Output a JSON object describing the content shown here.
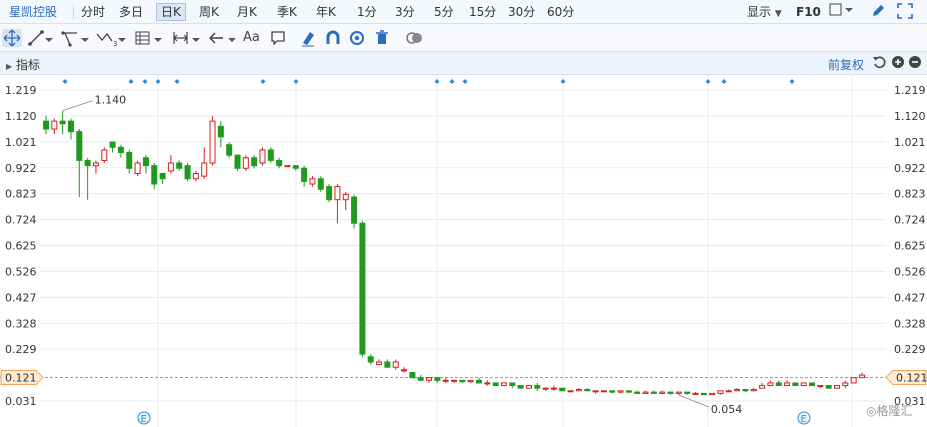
{
  "stock_name": "星凯控股",
  "period_tabs": [
    "分时",
    "多日",
    "日K",
    "周K",
    "月K",
    "季K",
    "年K",
    "1分",
    "3分",
    "5分",
    "15分",
    "30分",
    "60分"
  ],
  "active_tab": "日K",
  "display_label": "显示",
  "f10_label": "F10",
  "toolbar": {
    "text_tool_label": "Aa"
  },
  "header": {
    "indicator_label": "指标",
    "adjust_label": "前复权"
  },
  "watermark": "格隆汇",
  "event_marker": "E",
  "colors": {
    "up": "#d61f1f",
    "down": "#1f9a1f",
    "grid": "#e3ecf6",
    "current_price": "#f08a24",
    "accent": "#2a6bc4"
  },
  "chart_data": {
    "type": "candlestick",
    "title": "",
    "ylim": [
      0.0,
      1.25
    ],
    "y_ticks": [
      "1.219",
      "1.120",
      "1.021",
      "0.922",
      "0.823",
      "0.724",
      "0.625",
      "0.526",
      "0.427",
      "0.328",
      "0.229",
      "0.121",
      "0.031"
    ],
    "current_price": "0.121",
    "annotations": {
      "high": "1.140",
      "low": "0.054"
    },
    "event_dot_count": 14,
    "event_marker_count": 2,
    "candles": [
      [
        1.1,
        1.07,
        1.12,
        1.05
      ],
      [
        1.07,
        1.1,
        1.11,
        1.05
      ],
      [
        1.1,
        1.09,
        1.14,
        1.05
      ],
      [
        1.1,
        1.06,
        1.11,
        1.03
      ],
      [
        1.06,
        0.95,
        1.07,
        0.81
      ],
      [
        0.95,
        0.93,
        0.96,
        0.8
      ],
      [
        0.93,
        0.94,
        0.95,
        0.9
      ],
      [
        0.95,
        0.99,
        1.0,
        0.94
      ],
      [
        1.02,
        1.0,
        1.02,
        0.98
      ],
      [
        1.0,
        0.98,
        1.01,
        0.96
      ],
      [
        0.98,
        0.92,
        0.99,
        0.9
      ],
      [
        0.9,
        0.94,
        0.95,
        0.89
      ],
      [
        0.96,
        0.93,
        0.97,
        0.9
      ],
      [
        0.93,
        0.86,
        0.94,
        0.84
      ],
      [
        0.9,
        0.88,
        0.9,
        0.86
      ],
      [
        0.91,
        0.94,
        0.97,
        0.9
      ],
      [
        0.94,
        0.92,
        0.95,
        0.91
      ],
      [
        0.93,
        0.88,
        0.94,
        0.87
      ],
      [
        0.88,
        0.9,
        0.91,
        0.87
      ],
      [
        0.89,
        0.94,
        1.0,
        0.88
      ],
      [
        0.94,
        1.1,
        1.12,
        0.93
      ],
      [
        1.08,
        1.04,
        1.1,
        1.0
      ],
      [
        1.01,
        0.97,
        1.02,
        0.96
      ],
      [
        0.97,
        0.92,
        0.97,
        0.91
      ],
      [
        0.92,
        0.96,
        0.97,
        0.91
      ],
      [
        0.96,
        0.93,
        0.97,
        0.92
      ],
      [
        0.94,
        0.99,
        1.0,
        0.93
      ],
      [
        0.99,
        0.95,
        1.0,
        0.94
      ],
      [
        0.95,
        0.93,
        0.96,
        0.92
      ],
      [
        0.93,
        0.93,
        0.93,
        0.93
      ],
      [
        0.93,
        0.92,
        0.93,
        0.91
      ],
      [
        0.92,
        0.87,
        0.93,
        0.85
      ],
      [
        0.86,
        0.88,
        0.89,
        0.85
      ],
      [
        0.88,
        0.84,
        0.89,
        0.83
      ],
      [
        0.85,
        0.8,
        0.86,
        0.79
      ],
      [
        0.8,
        0.85,
        0.86,
        0.71
      ],
      [
        0.8,
        0.82,
        0.83,
        0.76
      ],
      [
        0.81,
        0.71,
        0.82,
        0.69
      ],
      [
        0.71,
        0.21,
        0.72,
        0.2
      ],
      [
        0.2,
        0.18,
        0.21,
        0.17
      ],
      [
        0.17,
        0.18,
        0.19,
        0.17
      ],
      [
        0.18,
        0.16,
        0.19,
        0.16
      ],
      [
        0.16,
        0.18,
        0.19,
        0.15
      ],
      [
        0.15,
        0.15,
        0.16,
        0.14
      ],
      [
        0.14,
        0.12,
        0.14,
        0.12
      ],
      [
        0.12,
        0.11,
        0.13,
        0.11
      ],
      [
        0.11,
        0.12,
        0.12,
        0.1
      ],
      [
        0.12,
        0.11,
        0.12,
        0.1
      ],
      [
        0.11,
        0.11,
        0.12,
        0.1
      ],
      [
        0.11,
        0.11,
        0.11,
        0.1
      ],
      [
        0.11,
        0.105,
        0.11,
        0.1
      ],
      [
        0.105,
        0.11,
        0.11,
        0.1
      ],
      [
        0.11,
        0.1,
        0.12,
        0.1
      ],
      [
        0.1,
        0.1,
        0.11,
        0.09
      ],
      [
        0.1,
        0.09,
        0.1,
        0.09
      ],
      [
        0.09,
        0.1,
        0.1,
        0.09
      ],
      [
        0.1,
        0.09,
        0.1,
        0.08
      ],
      [
        0.09,
        0.08,
        0.09,
        0.08
      ],
      [
        0.08,
        0.09,
        0.09,
        0.08
      ],
      [
        0.09,
        0.08,
        0.1,
        0.07
      ],
      [
        0.08,
        0.08,
        0.08,
        0.07
      ],
      [
        0.08,
        0.08,
        0.09,
        0.07
      ],
      [
        0.08,
        0.07,
        0.08,
        0.07
      ],
      [
        0.07,
        0.07,
        0.07,
        0.07
      ],
      [
        0.07,
        0.075,
        0.08,
        0.07
      ],
      [
        0.075,
        0.07,
        0.08,
        0.07
      ],
      [
        0.07,
        0.07,
        0.07,
        0.06
      ],
      [
        0.07,
        0.07,
        0.07,
        0.065
      ],
      [
        0.07,
        0.065,
        0.07,
        0.06
      ],
      [
        0.065,
        0.07,
        0.07,
        0.06
      ],
      [
        0.07,
        0.065,
        0.07,
        0.06
      ],
      [
        0.065,
        0.06,
        0.07,
        0.06
      ],
      [
        0.06,
        0.065,
        0.07,
        0.06
      ],
      [
        0.065,
        0.06,
        0.07,
        0.06
      ],
      [
        0.06,
        0.065,
        0.07,
        0.06
      ],
      [
        0.065,
        0.06,
        0.065,
        0.055
      ],
      [
        0.06,
        0.065,
        0.065,
        0.054
      ],
      [
        0.065,
        0.06,
        0.065,
        0.055
      ],
      [
        0.06,
        0.06,
        0.065,
        0.055
      ],
      [
        0.06,
        0.055,
        0.06,
        0.055
      ],
      [
        0.055,
        0.06,
        0.06,
        0.055
      ],
      [
        0.06,
        0.07,
        0.07,
        0.055
      ],
      [
        0.07,
        0.07,
        0.075,
        0.065
      ],
      [
        0.07,
        0.075,
        0.08,
        0.07
      ],
      [
        0.075,
        0.07,
        0.075,
        0.065
      ],
      [
        0.07,
        0.075,
        0.08,
        0.07
      ],
      [
        0.08,
        0.09,
        0.1,
        0.08
      ],
      [
        0.09,
        0.1,
        0.11,
        0.09
      ],
      [
        0.1,
        0.09,
        0.11,
        0.09
      ],
      [
        0.09,
        0.1,
        0.11,
        0.09
      ],
      [
        0.1,
        0.09,
        0.1,
        0.09
      ],
      [
        0.09,
        0.1,
        0.1,
        0.09
      ],
      [
        0.1,
        0.09,
        0.1,
        0.09
      ],
      [
        0.09,
        0.09,
        0.09,
        0.08
      ],
      [
        0.09,
        0.08,
        0.09,
        0.08
      ],
      [
        0.08,
        0.09,
        0.09,
        0.08
      ],
      [
        0.09,
        0.1,
        0.11,
        0.08
      ],
      [
        0.1,
        0.12,
        0.12,
        0.1
      ],
      [
        0.12,
        0.13,
        0.14,
        0.12
      ]
    ]
  }
}
